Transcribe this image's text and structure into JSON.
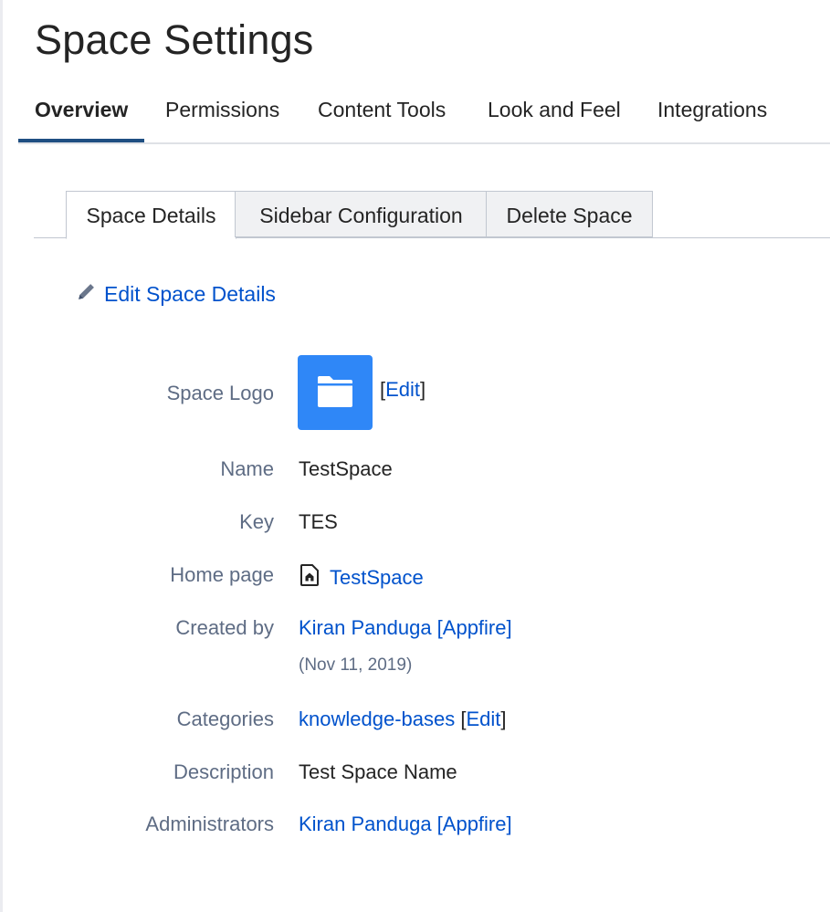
{
  "page": {
    "title": "Space Settings"
  },
  "tabs": [
    {
      "label": "Overview",
      "active": true
    },
    {
      "label": "Permissions"
    },
    {
      "label": "Content Tools"
    },
    {
      "label": "Look and Feel"
    },
    {
      "label": "Integrations"
    }
  ],
  "subtabs": [
    {
      "label": "Space Details",
      "active": true
    },
    {
      "label": "Sidebar Configuration"
    },
    {
      "label": "Delete Space"
    }
  ],
  "edit_details": {
    "label": "Edit Space Details",
    "icon": "pencil-icon"
  },
  "details": {
    "space_logo": {
      "label": "Space Logo",
      "edit": "Edit",
      "icon": "folder-icon",
      "tile_color": "#2f87f7"
    },
    "name": {
      "label": "Name",
      "value": "TestSpace"
    },
    "key": {
      "label": "Key",
      "value": "TES"
    },
    "home_page": {
      "label": "Home page",
      "value": "TestSpace",
      "icon": "home-page-icon"
    },
    "created_by": {
      "label": "Created by",
      "value": "Kiran Panduga [Appfire]",
      "date": "(Nov 11, 2019)"
    },
    "categories": {
      "label": "Categories",
      "value": "knowledge-bases",
      "edit": "Edit"
    },
    "description": {
      "label": "Description",
      "value": "Test Space Name"
    },
    "administrators": {
      "label": "Administrators",
      "value": "Kiran Panduga [Appfire]"
    }
  },
  "colors": {
    "link": "#0052cc",
    "active_tab_underline": "#1f4f82",
    "label": "#5e6c84"
  }
}
